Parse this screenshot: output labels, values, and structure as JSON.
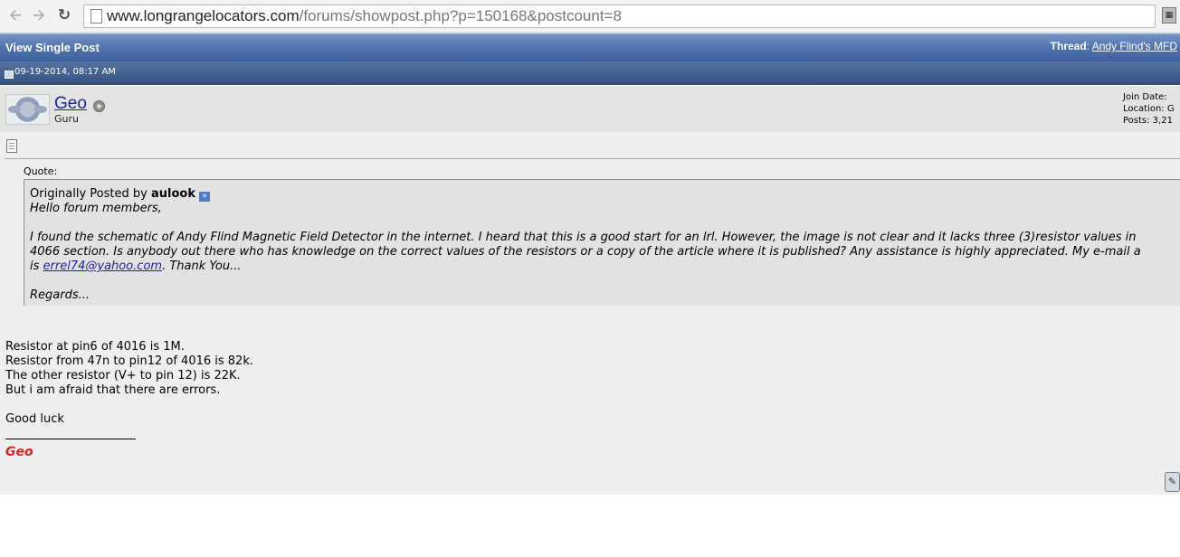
{
  "browser": {
    "url_host": "www.longrangelocators.com",
    "url_path": "/forums/showpost.php?p=150168&postcount=8"
  },
  "header": {
    "title": "View Single Post",
    "thread_label": "Thread",
    "thread_title": "Andy Flind's MFD"
  },
  "post": {
    "date": "09-19-2014, 08:17 AM",
    "user": {
      "name": "Geo",
      "rank": "Guru",
      "stats": [
        "Join Date: ",
        "Location: G",
        "Posts: 3,21"
      ]
    },
    "quote": {
      "label": "Quote:",
      "originally_posted_by": "Originally Posted by",
      "author": "aulook",
      "lines": [
        "Hello forum members,",
        "I found the schematic of Andy Flind Magnetic Field Detector in the internet. I heard that this is a good start for an lrl. However, the image is not clear and it lacks three (3)resistor values in",
        "4066 section. Is anybody out there who has knowledge on the correct values of the resistors or a copy of the article where it is published? Any assistance is highly appreciated. My e-mail a",
        "is",
        "errel74@yahoo.com",
        ". Thank You...",
        "Regards..."
      ]
    },
    "reply": [
      "Resistor at pin6 of 4016 is 1M.",
      "Resistor from 47n to pin12 of 4016 is 82k.",
      "The other resistor (V+ to pin 12) is 22K.",
      "But i am afraid that there are errors.",
      "Good luck"
    ],
    "signature": "Geo"
  }
}
